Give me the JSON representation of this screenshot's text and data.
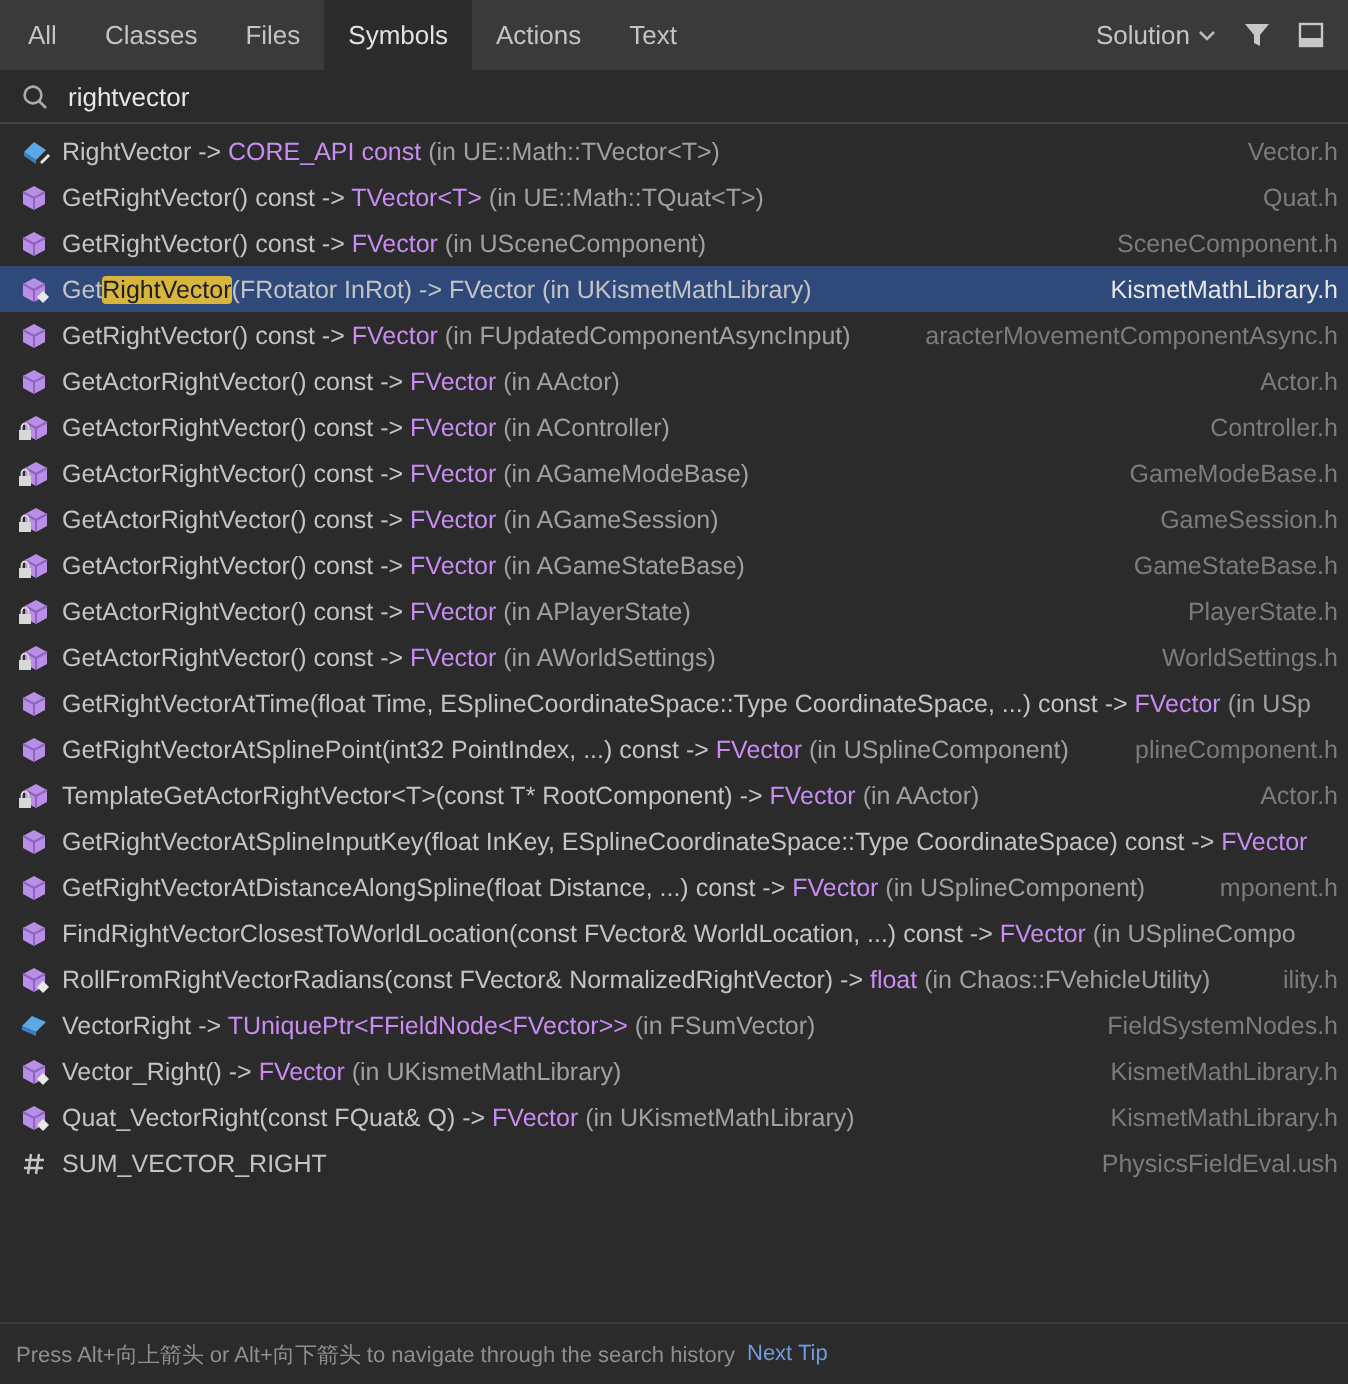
{
  "tabs": [
    {
      "label": "All",
      "selected": false
    },
    {
      "label": "Classes",
      "selected": false
    },
    {
      "label": "Files",
      "selected": false
    },
    {
      "label": "Symbols",
      "selected": true
    },
    {
      "label": "Actions",
      "selected": false
    },
    {
      "label": "Text",
      "selected": false
    }
  ],
  "scope_dropdown": {
    "label": "Solution"
  },
  "search": {
    "value": "rightvector"
  },
  "results": [
    {
      "kind": "property",
      "selected": false,
      "file": "Vector.h",
      "segments": [
        {
          "kind": "name",
          "text": "RightVector -> "
        },
        {
          "kind": "type",
          "text": "CORE_API const"
        },
        {
          "kind": "scope",
          "text": " (in UE::Math::TVector<T>)"
        }
      ]
    },
    {
      "kind": "method",
      "selected": false,
      "file": "Quat.h",
      "segments": [
        {
          "kind": "name",
          "text": "GetRightVector() const -> "
        },
        {
          "kind": "type",
          "text": "TVector<T>"
        },
        {
          "kind": "scope",
          "text": " (in UE::Math::TQuat<T>)"
        }
      ]
    },
    {
      "kind": "method",
      "selected": false,
      "file": "SceneComponent.h",
      "segments": [
        {
          "kind": "name",
          "text": "GetRightVector() const -> "
        },
        {
          "kind": "type",
          "text": "FVector"
        },
        {
          "kind": "scope",
          "text": " (in USceneComponent)"
        }
      ]
    },
    {
      "kind": "extension",
      "selected": true,
      "file": "KismetMathLibrary.h",
      "segments": [
        {
          "kind": "name",
          "text": "Get"
        },
        {
          "kind": "match",
          "text": "RightVector"
        },
        {
          "kind": "name",
          "text": "(FRotator InRot) -> FVector (in UKismetMathLibrary)"
        }
      ]
    },
    {
      "kind": "method",
      "selected": false,
      "file": "aracterMovementComponentAsync.h",
      "segments": [
        {
          "kind": "name",
          "text": "GetRightVector() const -> "
        },
        {
          "kind": "type",
          "text": "FVector"
        },
        {
          "kind": "scope",
          "text": " (in FUpdatedComponentAsyncInput)"
        }
      ]
    },
    {
      "kind": "method",
      "selected": false,
      "file": "Actor.h",
      "segments": [
        {
          "kind": "name",
          "text": "GetActorRightVector() const -> "
        },
        {
          "kind": "type",
          "text": "FVector"
        },
        {
          "kind": "scope",
          "text": " (in AActor)"
        }
      ]
    },
    {
      "kind": "locked",
      "selected": false,
      "file": "Controller.h",
      "segments": [
        {
          "kind": "name",
          "text": "GetActorRightVector() const -> "
        },
        {
          "kind": "type",
          "text": "FVector"
        },
        {
          "kind": "scope",
          "text": " (in AController)"
        }
      ]
    },
    {
      "kind": "locked",
      "selected": false,
      "file": "GameModeBase.h",
      "segments": [
        {
          "kind": "name",
          "text": "GetActorRightVector() const -> "
        },
        {
          "kind": "type",
          "text": "FVector"
        },
        {
          "kind": "scope",
          "text": " (in AGameModeBase)"
        }
      ]
    },
    {
      "kind": "locked",
      "selected": false,
      "file": "GameSession.h",
      "segments": [
        {
          "kind": "name",
          "text": "GetActorRightVector() const -> "
        },
        {
          "kind": "type",
          "text": "FVector"
        },
        {
          "kind": "scope",
          "text": " (in AGameSession)"
        }
      ]
    },
    {
      "kind": "locked",
      "selected": false,
      "file": "GameStateBase.h",
      "segments": [
        {
          "kind": "name",
          "text": "GetActorRightVector() const -> "
        },
        {
          "kind": "type",
          "text": "FVector"
        },
        {
          "kind": "scope",
          "text": " (in AGameStateBase)"
        }
      ]
    },
    {
      "kind": "locked",
      "selected": false,
      "file": "PlayerState.h",
      "segments": [
        {
          "kind": "name",
          "text": "GetActorRightVector() const -> "
        },
        {
          "kind": "type",
          "text": "FVector"
        },
        {
          "kind": "scope",
          "text": " (in APlayerState)"
        }
      ]
    },
    {
      "kind": "locked",
      "selected": false,
      "file": "WorldSettings.h",
      "segments": [
        {
          "kind": "name",
          "text": "GetActorRightVector() const -> "
        },
        {
          "kind": "type",
          "text": "FVector"
        },
        {
          "kind": "scope",
          "text": " (in AWorldSettings)"
        }
      ]
    },
    {
      "kind": "method",
      "selected": false,
      "segments": [
        {
          "kind": "name",
          "text": "GetRightVectorAtTime(float Time, ESplineCoordinateSpace::Type CoordinateSpace, ...) const -> "
        },
        {
          "kind": "type",
          "text": "FVector"
        },
        {
          "kind": "scope",
          "text": " (in USp"
        }
      ]
    },
    {
      "kind": "method",
      "selected": false,
      "file": "plineComponent.h",
      "segments": [
        {
          "kind": "name",
          "text": "GetRightVectorAtSplinePoint(int32 PointIndex, ...) const -> "
        },
        {
          "kind": "type",
          "text": "FVector"
        },
        {
          "kind": "scope",
          "text": " (in USplineComponent)"
        }
      ]
    },
    {
      "kind": "locked",
      "selected": false,
      "file": "Actor.h",
      "segments": [
        {
          "kind": "name",
          "text": "TemplateGetActorRightVector<T>(const T* RootComponent) -> "
        },
        {
          "kind": "type",
          "text": "FVector"
        },
        {
          "kind": "scope",
          "text": " (in AActor)"
        }
      ]
    },
    {
      "kind": "method",
      "selected": false,
      "segments": [
        {
          "kind": "name",
          "text": "GetRightVectorAtSplineInputKey(float InKey, ESplineCoordinateSpace::Type CoordinateSpace) const -> "
        },
        {
          "kind": "type",
          "text": "FVector"
        }
      ]
    },
    {
      "kind": "method",
      "selected": false,
      "file": "mponent.h",
      "segments": [
        {
          "kind": "name",
          "text": "GetRightVectorAtDistanceAlongSpline(float Distance, ...) const -> "
        },
        {
          "kind": "type",
          "text": "FVector"
        },
        {
          "kind": "scope",
          "text": " (in USplineComponent)"
        }
      ]
    },
    {
      "kind": "method",
      "selected": false,
      "segments": [
        {
          "kind": "name",
          "text": "FindRightVectorClosestToWorldLocation(const FVector& WorldLocation, ...) const -> "
        },
        {
          "kind": "type",
          "text": "FVector"
        },
        {
          "kind": "scope",
          "text": " (in USplineCompo"
        }
      ]
    },
    {
      "kind": "extension",
      "selected": false,
      "file": "ility.h",
      "segments": [
        {
          "kind": "name",
          "text": "RollFromRightVectorRadians(const FVector& NormalizedRightVector) -> "
        },
        {
          "kind": "type",
          "text": "float"
        },
        {
          "kind": "scope",
          "text": " (in Chaos::FVehicleUtility)"
        }
      ]
    },
    {
      "kind": "field",
      "selected": false,
      "file": "FieldSystemNodes.h",
      "segments": [
        {
          "kind": "name",
          "text": "VectorRight -> "
        },
        {
          "kind": "type",
          "text": "TUniquePtr<FFieldNode<FVector>>"
        },
        {
          "kind": "scope",
          "text": " (in FSumVector)"
        }
      ]
    },
    {
      "kind": "extension",
      "selected": false,
      "file": "KismetMathLibrary.h",
      "segments": [
        {
          "kind": "name",
          "text": "Vector_Right() -> "
        },
        {
          "kind": "type",
          "text": "FVector"
        },
        {
          "kind": "scope",
          "text": " (in UKismetMathLibrary)"
        }
      ]
    },
    {
      "kind": "extension",
      "selected": false,
      "file": "KismetMathLibrary.h",
      "segments": [
        {
          "kind": "name",
          "text": "Quat_VectorRight(const FQuat& Q) -> "
        },
        {
          "kind": "type",
          "text": "FVector"
        },
        {
          "kind": "scope",
          "text": " (in UKismetMathLibrary)"
        }
      ]
    },
    {
      "kind": "macro",
      "selected": false,
      "file": "PhysicsFieldEval.ush",
      "segments": [
        {
          "kind": "name",
          "text": "SUM_VECTOR_RIGHT"
        }
      ]
    }
  ],
  "footer": {
    "tip": "Press Alt+向上箭头 or Alt+向下箭头 to navigate through the search history",
    "link": "Next Tip"
  }
}
